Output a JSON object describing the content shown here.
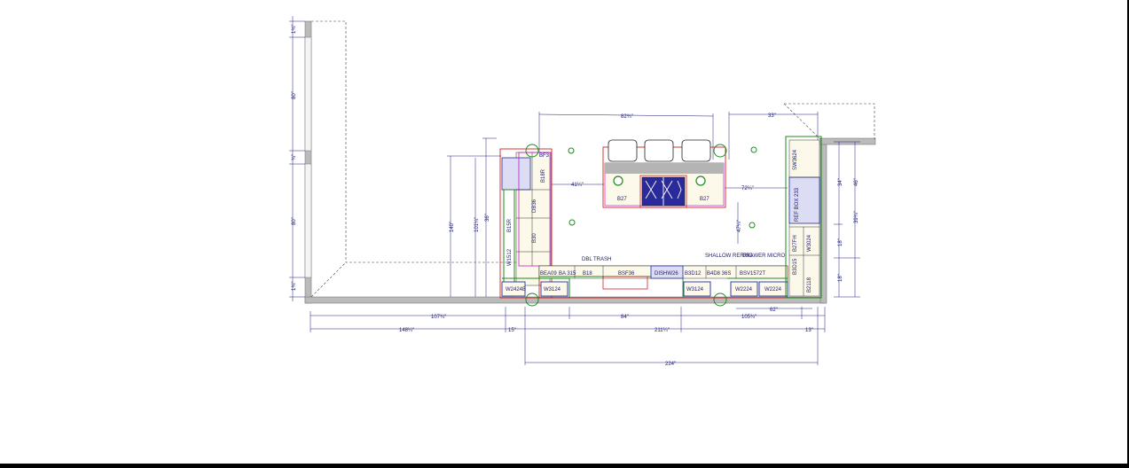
{
  "dimensions": {
    "wall_left_segments": [
      "1¾\"",
      "80\"",
      "¾\"",
      "80\"",
      "1¾\""
    ],
    "top_island_width": "82¾\"",
    "top_right_depth": "33\"",
    "island_gap_left": "41¼\"",
    "island_gap_right": "72¼\"",
    "left_height_outer": "140\"",
    "left_height_mid": "101¼\"",
    "left_height_inner": "36\"",
    "bottom_row1": [
      "107¾\"",
      "84\"",
      "105¾\"",
      "62\""
    ],
    "bottom_row2": [
      "148¼\"",
      "15\"",
      "211¼\"",
      "13\""
    ],
    "bottom_total": "224\"",
    "right_vertical": [
      "34\"",
      "18\"",
      "18\"",
      "46\"",
      "39¾\""
    ],
    "island_right_height": "47¼\""
  },
  "labels": {
    "left_run": [
      "B18R",
      "DB36",
      "B30",
      "B15R",
      "W1512",
      "BF3"
    ],
    "base_run": [
      "BEA09",
      "BA 315",
      "B18",
      "BSF36",
      "DISHW26",
      "B3D12",
      "B4D8 36S",
      "BSV1572T"
    ],
    "wall_run": [
      "W2424B",
      "W3124",
      "W3124",
      "W2224",
      "W2224",
      "W4D18"
    ],
    "island": [
      "B27",
      "B27"
    ],
    "right_run": [
      "SW3624",
      "REF BOX 233",
      "B27FH",
      "W3024",
      "B3D15",
      "B2118"
    ],
    "notes": [
      "DBL TRASH",
      "SHALLOW REFRIG",
      "DRAWER MICRO"
    ]
  },
  "colors": {
    "wall": "#bbbbbb",
    "dimension": "#1a1a7a",
    "red_outline": "#d42020",
    "green_outline": "#1f8a1f",
    "blue_outline": "#1f2f9a",
    "magenta_outline": "#c21ccc",
    "cabinet_fill": "#fdf9ea",
    "appliance_fill": "#dcdcf5",
    "cooktop": "#2a2a9a",
    "island_counter": "#b4b4b4"
  }
}
